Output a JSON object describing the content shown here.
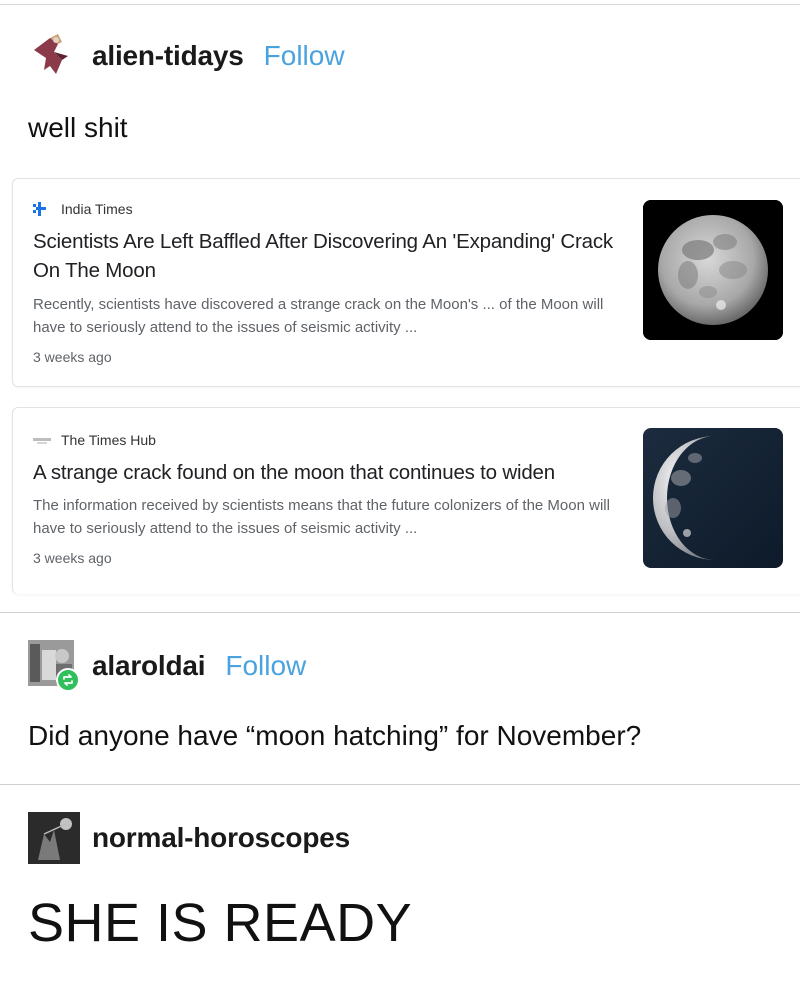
{
  "posts": [
    {
      "username": "alien-tidays",
      "follow_label": "Follow",
      "text": "well shit",
      "cards": [
        {
          "source": "India Times",
          "headline": "Scientists Are Left Baffled After Discovering An 'Expanding' Crack On The Moon",
          "snippet": "Recently, scientists have discovered a strange crack on the Moon's ... of the Moon will have to seriously attend to the issues of seismic activity ...",
          "age": "3 weeks ago",
          "thumbnail": "full-moon-image"
        },
        {
          "source": "The Times Hub",
          "headline": "A strange crack found on the moon that continues to widen",
          "snippet": "The information received by scientists means that the future colonizers of the Moon will have to seriously attend to the issues of seismic activity ...",
          "age": "3 weeks ago",
          "thumbnail": "waxing-moon-image"
        }
      ]
    },
    {
      "username": "alaroldai",
      "follow_label": "Follow",
      "text": "Did anyone have “moon hatching” for November?"
    },
    {
      "username": "normal-horoscopes",
      "text": "SHE IS READY"
    }
  ],
  "colors": {
    "follow": "#4aa3df",
    "reblog_badge": "#2fbf5b",
    "divider": "#cfcfcf"
  }
}
